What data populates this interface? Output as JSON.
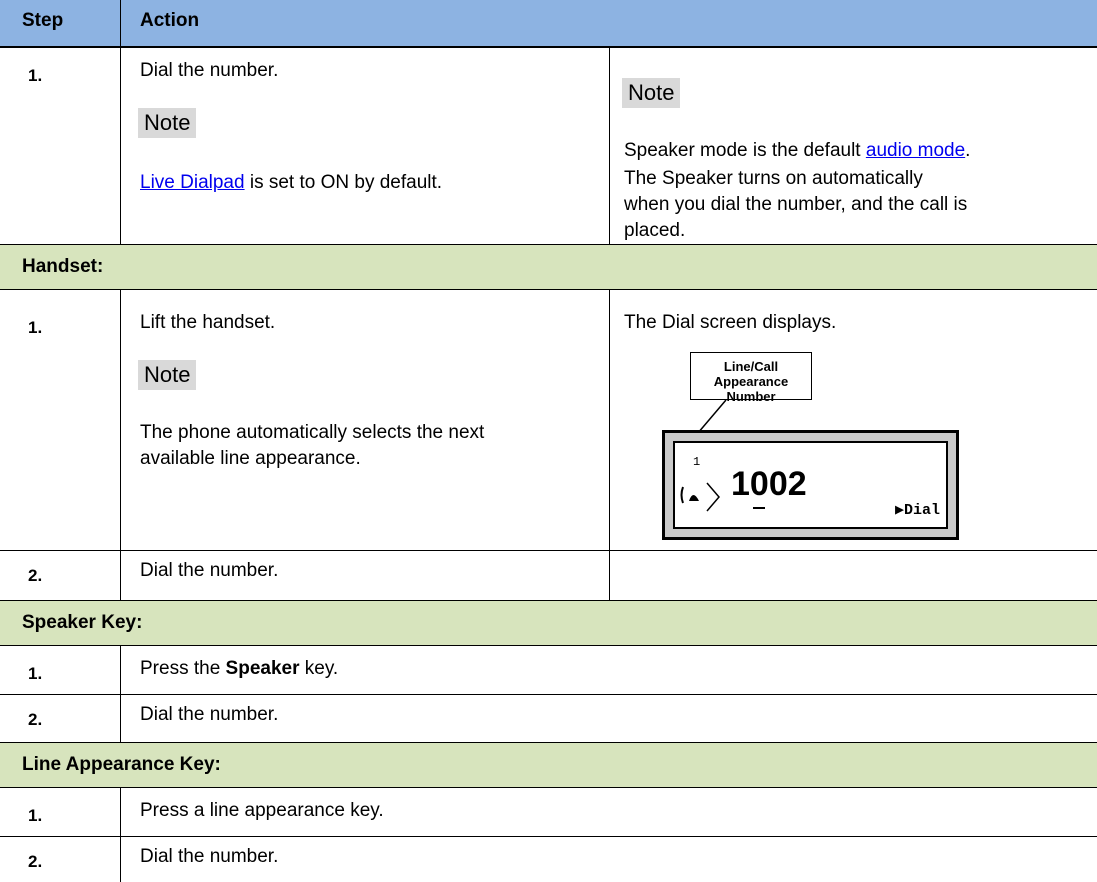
{
  "header": {
    "step_label": "Step",
    "action_label": "Action"
  },
  "row1": {
    "step": "1.",
    "action": "Dial the number.",
    "note_label": "Note",
    "note_link": "Live Dialpad",
    "note_rest": " is set to ON by default.",
    "result_note_label": "Note",
    "result_prefix": "Speaker mode is the default ",
    "result_link": "audio mode",
    "result_suffix": ".",
    "result_line2": "The Speaker turns on automatically",
    "result_line3": "when you dial the number, and the call is",
    "result_line4": "placed."
  },
  "handset": {
    "title": "Handset:",
    "step1": "1.",
    "action1": "Lift the handset.",
    "note_label": "Note",
    "note_line1": "The phone automatically selects the next",
    "note_line2": "available line appearance.",
    "result1": "The Dial screen displays.",
    "callout_line1": "Line/Call Appearance",
    "callout_line2": "Number",
    "lcd_line_number": "1",
    "lcd_number": "1002",
    "lcd_softkey": "Dial",
    "step2": "2.",
    "action2": "Dial the number."
  },
  "speaker": {
    "title": "Speaker Key:",
    "step1": "1.",
    "action1_prefix": "Press the ",
    "action1_bold": "Speaker",
    "action1_suffix": " key.",
    "step2": "2.",
    "action2": "Dial the number."
  },
  "lineapp": {
    "title": "Line Appearance Key:",
    "step1": "1.",
    "action1": "Press a line appearance key.",
    "step2": "2.",
    "action2": "Dial the number."
  },
  "icons": {
    "lcd_handset": "handset-icon",
    "lcd_arrow": "play-arrow-icon",
    "callout_pointer": "pointer-line-icon"
  },
  "colors": {
    "header_bg": "#8db3e2",
    "section_bg": "#d7e4bd",
    "note_bg": "#d9d9d9",
    "link": "#0000ee"
  }
}
